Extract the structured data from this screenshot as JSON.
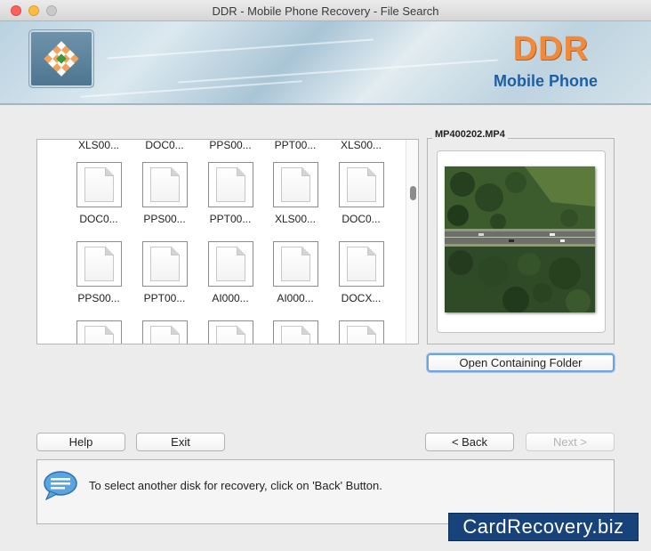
{
  "window": {
    "title": "DDR - Mobile Phone Recovery - File Search"
  },
  "banner": {
    "brand": "DDR",
    "subbrand": "Mobile Phone"
  },
  "file_grid": {
    "partial_top_labels": [
      "XLS00...",
      "DOC0...",
      "PPS00...",
      "PPT00...",
      "XLS00..."
    ],
    "rows": [
      [
        "DOC0...",
        "PPS00...",
        "PPT00...",
        "XLS00...",
        "DOC0..."
      ],
      [
        "PPS00...",
        "PPT00...",
        "AI000...",
        "AI000...",
        "DOCX..."
      ],
      [
        "",
        "",
        "",
        "",
        ""
      ]
    ]
  },
  "preview": {
    "filename": "MP400202.MP4",
    "open_folder_label": "Open Containing Folder"
  },
  "buttons": {
    "help": "Help",
    "exit": "Exit",
    "back": "< Back",
    "next": "Next >"
  },
  "message": {
    "text": "To select another disk for recovery, click on 'Back' Button."
  },
  "watermark": "CardRecovery.biz"
}
